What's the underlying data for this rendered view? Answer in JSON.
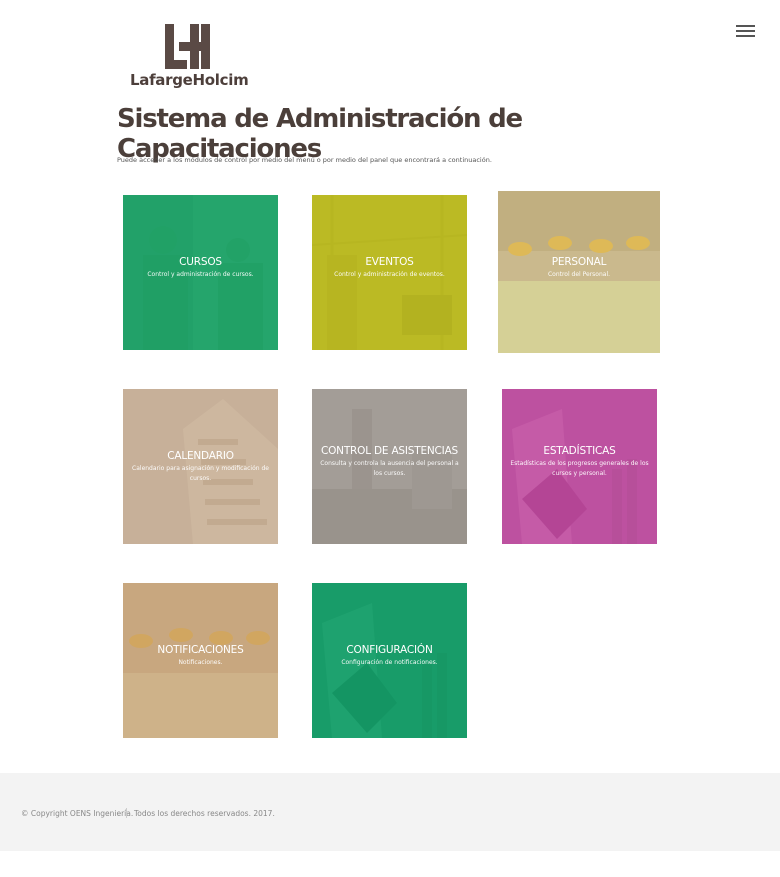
{
  "brand": {
    "name": "LafargeHolcim",
    "color": "#5a4a45"
  },
  "menu": {
    "icon": "hamburger-menu-icon"
  },
  "page": {
    "title": "Sistema de Administración de Capacitaciones",
    "intro": "Puede acceder a los módulos de control por medio del menú o por medio del panel que encontrará a continuación."
  },
  "tiles": [
    {
      "key": "cursos",
      "title": "CURSOS",
      "description": "Control y administración de cursos.",
      "color": "#1fa86a"
    },
    {
      "key": "eventos",
      "title": "EVENTOS",
      "description": "Control y administración de eventos.",
      "color": "#bfbe1f"
    },
    {
      "key": "personal",
      "title": "PERSONAL",
      "description": "Control del Personal.",
      "color": "#c9b98a"
    },
    {
      "key": "calendario",
      "title": "CALENDARIO",
      "description": "Calendario para asignación y modificación de cursos.",
      "color": "#c8ae95"
    },
    {
      "key": "asistencias",
      "title": "CONTROL DE ASISTENCIAS",
      "description": "Consulta y controla la ausencia del personal a los cursos.",
      "color": "#9d9690"
    },
    {
      "key": "estadisticas",
      "title": "ESTADÍSTICAS",
      "description": "Estadísticas de los progresos generales de los cursos y personal.",
      "color": "#c24ea3"
    },
    {
      "key": "notificaciones",
      "title": "NOTIFICACIONES",
      "description": "Notificaciones.",
      "color": "#c9a57c"
    },
    {
      "key": "configuracion",
      "title": "CONFIGURACIÓN",
      "description": "Configuración de notificaciones.",
      "color": "#18a06a"
    }
  ],
  "footer": {
    "copyright": "© Copyright OENS Ingeniería.",
    "rights": "Todos los derechos reservados. 2017."
  }
}
